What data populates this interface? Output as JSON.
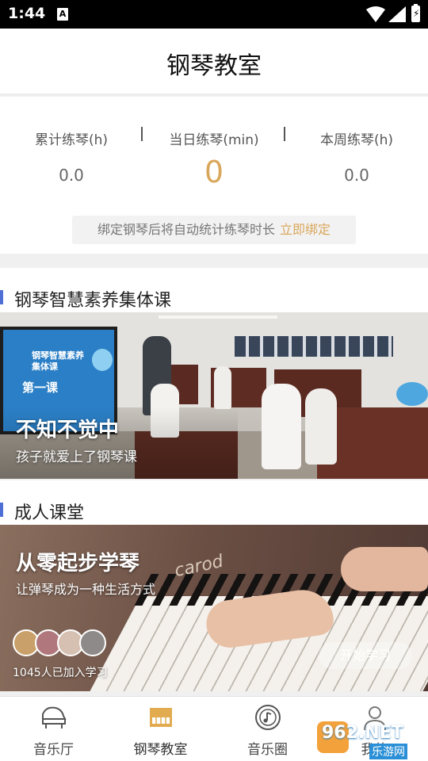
{
  "status_bar": {
    "time": "1:44",
    "notif_icon": "A"
  },
  "header": {
    "title": "钢琴教室"
  },
  "stats": [
    {
      "label": "累计练琴(h)",
      "value": "0.0"
    },
    {
      "label": "当日练琴(min)",
      "value": "0"
    },
    {
      "label": "本周练琴(h)",
      "value": "0.0"
    }
  ],
  "bind": {
    "text": "绑定钢琴后将自动统计练琴时长",
    "link": "立即绑定"
  },
  "sections": {
    "group": {
      "title": "钢琴智慧素养集体课",
      "banner_title": "不知不觉中",
      "banner_sub": "孩子就爱上了钢琴课",
      "screen_title": "钢琴智慧素养\n集体课",
      "screen_lesson": "第一课"
    },
    "adult": {
      "title": "成人课堂",
      "banner_title": "从零起步学琴",
      "banner_sub": "让弹琴成为一种生活方式",
      "brand": "carod",
      "joined": "1045人已加入学习",
      "cta": "开始学习"
    }
  },
  "tabs": [
    {
      "label": "音乐厅",
      "icon": "grand-piano-icon"
    },
    {
      "label": "钢琴教室",
      "icon": "upright-piano-icon",
      "active": true
    },
    {
      "label": "音乐圈",
      "icon": "music-disc-icon"
    },
    {
      "label": "我的",
      "icon": "user-icon"
    }
  ],
  "watermark": {
    "text": "962.NET",
    "sub": "乐游网"
  },
  "colors": {
    "accent_gold": "#d9a75b",
    "section_bar": "#4d6fd6"
  }
}
